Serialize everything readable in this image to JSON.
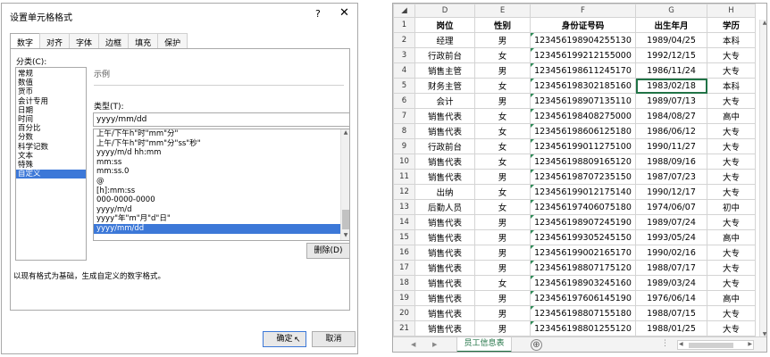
{
  "dialog": {
    "title": "设置单元格格式",
    "help": "?",
    "close": "✕",
    "tabs": [
      "数字",
      "对齐",
      "字体",
      "边框",
      "填充",
      "保护"
    ],
    "category_label": "分类(C):",
    "categories": [
      "常规",
      "数值",
      "货币",
      "会计专用",
      "日期",
      "时间",
      "百分比",
      "分数",
      "科学记数",
      "文本",
      "特殊",
      "自定义"
    ],
    "selected_category": "自定义",
    "sample_label": "示例",
    "type_label": "类型(T):",
    "type_value": "yyyy/mm/dd",
    "formats": [
      "上午/下午h\"时\"mm\"分\"",
      "上午/下午h\"时\"mm\"分\"ss\"秒\"",
      "yyyy/m/d hh:mm",
      "mm:ss",
      "mm:ss.0",
      "@",
      "[h]:mm:ss",
      "000-0000-0000",
      "yyyy/m/d",
      "yyyy\"年\"m\"月\"d\"日\"",
      "yyyy/mm/dd"
    ],
    "selected_format": "yyyy/mm/dd",
    "delete_label": "删除(D)",
    "description": "以现有格式为基础，生成自定义的数字格式。",
    "ok_label": "确定",
    "cancel_label": "取消"
  },
  "sheet": {
    "columns": [
      "D",
      "E",
      "F",
      "G",
      "H"
    ],
    "rows": [
      {
        "n": "1",
        "cells": [
          "岗位",
          "性别",
          "身份证号码",
          "出生年月",
          "学历"
        ]
      },
      {
        "n": "2",
        "cells": [
          "经理",
          "男",
          "123456198904255130",
          "1989/04/25",
          "本科"
        ]
      },
      {
        "n": "3",
        "cells": [
          "行政前台",
          "女",
          "123456199212155000",
          "1992/12/15",
          "大专"
        ]
      },
      {
        "n": "4",
        "cells": [
          "销售主管",
          "男",
          "123456198611245170",
          "1986/11/24",
          "大专"
        ]
      },
      {
        "n": "5",
        "cells": [
          "财务主管",
          "女",
          "123456198302185160",
          "1983/02/18",
          "本科"
        ]
      },
      {
        "n": "6",
        "cells": [
          "会计",
          "男",
          "123456198907135110",
          "1989/07/13",
          "大专"
        ]
      },
      {
        "n": "7",
        "cells": [
          "销售代表",
          "女",
          "123456198408275000",
          "1984/08/27",
          "高中"
        ]
      },
      {
        "n": "8",
        "cells": [
          "销售代表",
          "女",
          "123456198606125180",
          "1986/06/12",
          "大专"
        ]
      },
      {
        "n": "9",
        "cells": [
          "行政前台",
          "女",
          "123456199011275100",
          "1990/11/27",
          "大专"
        ]
      },
      {
        "n": "10",
        "cells": [
          "销售代表",
          "女",
          "123456198809165120",
          "1988/09/16",
          "大专"
        ]
      },
      {
        "n": "11",
        "cells": [
          "销售代表",
          "男",
          "123456198707235150",
          "1987/07/23",
          "大专"
        ]
      },
      {
        "n": "12",
        "cells": [
          "出纳",
          "女",
          "123456199012175140",
          "1990/12/17",
          "大专"
        ]
      },
      {
        "n": "13",
        "cells": [
          "后勤人员",
          "女",
          "123456197406075180",
          "1974/06/07",
          "初中"
        ]
      },
      {
        "n": "14",
        "cells": [
          "销售代表",
          "男",
          "123456198907245190",
          "1989/07/24",
          "大专"
        ]
      },
      {
        "n": "15",
        "cells": [
          "销售代表",
          "男",
          "123456199305245150",
          "1993/05/24",
          "高中"
        ]
      },
      {
        "n": "16",
        "cells": [
          "销售代表",
          "男",
          "123456199002165170",
          "1990/02/16",
          "大专"
        ]
      },
      {
        "n": "17",
        "cells": [
          "销售代表",
          "男",
          "123456198807175120",
          "1988/07/17",
          "大专"
        ]
      },
      {
        "n": "18",
        "cells": [
          "销售代表",
          "女",
          "123456198903245160",
          "1989/03/24",
          "大专"
        ]
      },
      {
        "n": "19",
        "cells": [
          "销售代表",
          "男",
          "123456197606145190",
          "1976/06/14",
          "高中"
        ]
      },
      {
        "n": "20",
        "cells": [
          "销售代表",
          "男",
          "123456198807155180",
          "1988/07/15",
          "大专"
        ]
      },
      {
        "n": "21",
        "cells": [
          "销售代表",
          "男",
          "123456198801255120",
          "1988/01/25",
          "大专"
        ]
      }
    ],
    "active_cell": "G5",
    "sheet_tab": "员工信息表",
    "add_sheet": "⊕"
  },
  "colors": {
    "selection": "#3c78d8",
    "excel_green": "#217346"
  }
}
